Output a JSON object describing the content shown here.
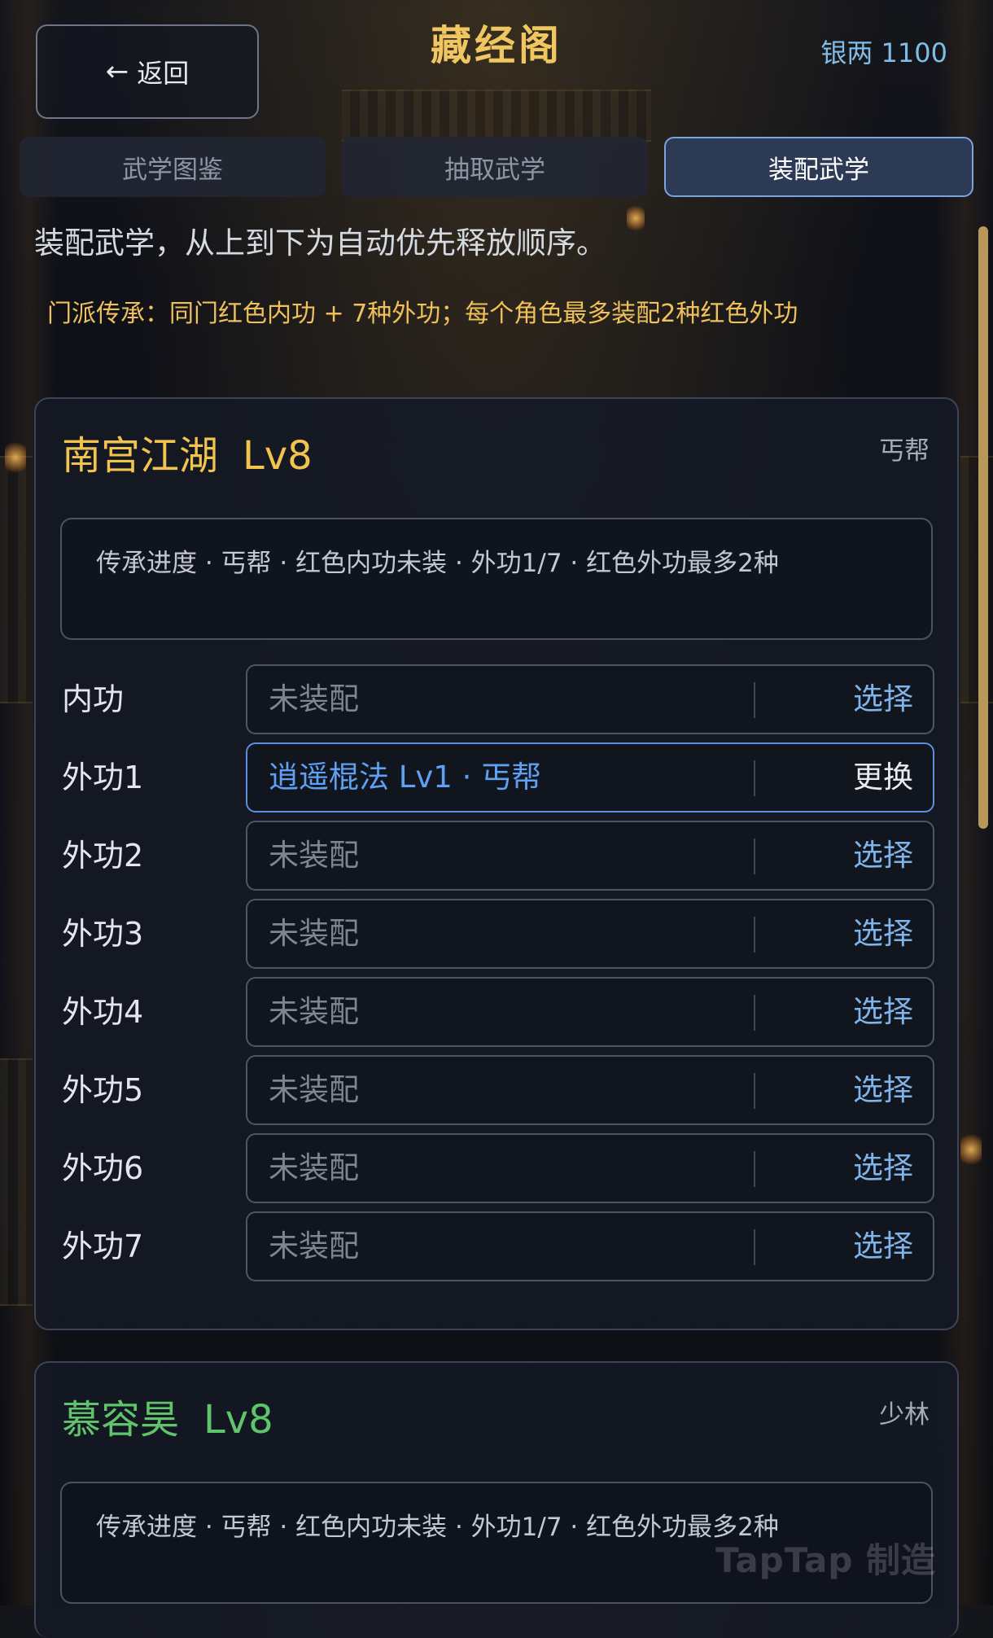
{
  "header": {
    "back_label": "返回",
    "title": "藏经阁",
    "silver": "银两 1100"
  },
  "tabs": [
    {
      "label": "武学图鉴",
      "active": false
    },
    {
      "label": "抽取武学",
      "active": false
    },
    {
      "label": "装配武学",
      "active": true
    }
  ],
  "intro": "装配武学，从上到下为自动优先释放顺序。",
  "rule": "门派传承：同门红色内功 + 7种外功；每个角色最多装配2种红色外功",
  "characters": [
    {
      "name": "南宫江湖",
      "level": "Lv8",
      "name_color": "#f2c44e",
      "faction": "丐帮",
      "progress": "传承进度 · 丐帮 · 红色内功未装 · 外功1/7 · 红色外功最多2种",
      "slots": [
        {
          "label": "内功",
          "value": "未装配",
          "action": "选择"
        },
        {
          "label": "外功1",
          "value": "逍遥棍法 Lv1 · 丐帮",
          "action": "更换"
        },
        {
          "label": "外功2",
          "value": "未装配",
          "action": "选择"
        },
        {
          "label": "外功3",
          "value": "未装配",
          "action": "选择"
        },
        {
          "label": "外功4",
          "value": "未装配",
          "action": "选择"
        },
        {
          "label": "外功5",
          "value": "未装配",
          "action": "选择"
        },
        {
          "label": "外功6",
          "value": "未装配",
          "action": "选择"
        },
        {
          "label": "外功7",
          "value": "未装配",
          "action": "选择"
        }
      ]
    },
    {
      "name": "慕容昊",
      "level": "Lv8",
      "name_color": "#5fc46a",
      "faction": "少林",
      "progress": "传承进度 · 丐帮 · 红色内功未装 · 外功1/7 · 红色外功最多2种"
    }
  ],
  "watermark": "TapTap 制造",
  "colors": {
    "accent_gold": "#f0c660",
    "accent_blue": "#7fbde8",
    "active_tab_border": "#7da3dc"
  }
}
